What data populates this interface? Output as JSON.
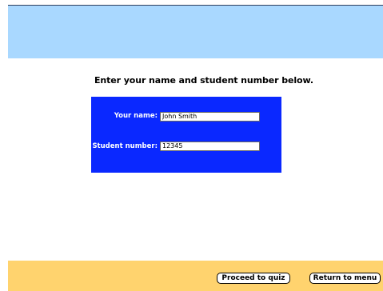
{
  "instruction": "Enter your name and student number below.",
  "form": {
    "name_label": "Your name:",
    "name_value": "John Smith",
    "student_label": "Student number:",
    "student_value": "12345"
  },
  "buttons": {
    "proceed": "Proceed to quiz",
    "return": "Return to menu"
  },
  "colors": {
    "header_band": "#a9d8ff",
    "form_panel": "#0a28ff",
    "footer_band": "#ffd36e"
  }
}
